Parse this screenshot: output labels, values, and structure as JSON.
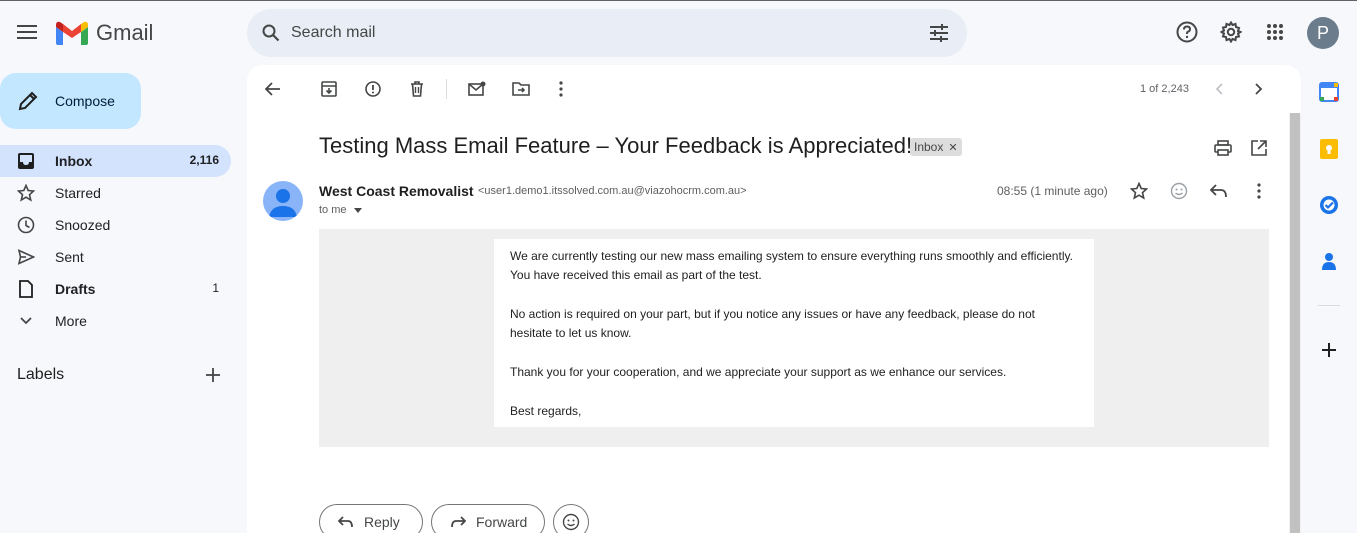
{
  "app": {
    "name": "Gmail"
  },
  "search": {
    "placeholder": "Search mail"
  },
  "header": {
    "avatar_letter": "P"
  },
  "sidebar": {
    "compose_label": "Compose",
    "items": [
      {
        "label": "Inbox",
        "count": "2,116",
        "icon": "inbox-icon"
      },
      {
        "label": "Starred",
        "count": "",
        "icon": "star-icon"
      },
      {
        "label": "Snoozed",
        "count": "",
        "icon": "clock-icon"
      },
      {
        "label": "Sent",
        "count": "",
        "icon": "send-icon"
      },
      {
        "label": "Drafts",
        "count": "1",
        "icon": "draft-icon"
      },
      {
        "label": "More",
        "count": "",
        "icon": "chevron-down-icon"
      }
    ],
    "labels_title": "Labels"
  },
  "toolbar": {
    "pager": "1 of 2,243"
  },
  "email": {
    "subject": "Testing Mass Email Feature – Your Feedback is Appreciated!",
    "chip": "Inbox",
    "sender_name": "West Coast Removalist",
    "sender_email": "<user1.demo1.itssolved.com.au@viazohocrm.com.au>",
    "to": "to me",
    "time": "08:55 (1 minute ago)",
    "paragraphs": [
      "We are currently testing our new mass emailing system to ensure everything runs smoothly and efficiently. You have received this email as part of the test.",
      "No action is required on your part, but if you notice any issues or have any feedback, please do not hesitate to let us know.",
      "Thank you for your cooperation, and we appreciate your support as we enhance our services.",
      "Best regards,"
    ]
  },
  "actions": {
    "reply": "Reply",
    "forward": "Forward"
  },
  "colors": {
    "accent": "#c2e7ff",
    "active_nav": "#d3e3fd",
    "background": "#f6f8fc"
  }
}
